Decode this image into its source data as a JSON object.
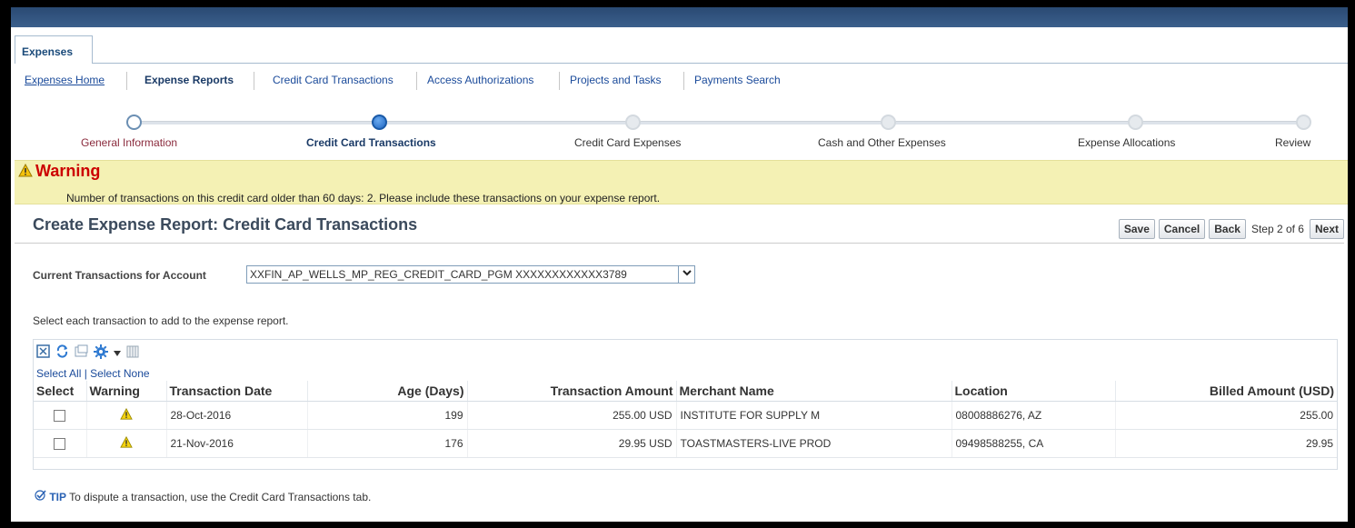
{
  "nav": {
    "tab": "Expenses",
    "subnav": [
      "Expenses Home",
      "Expense Reports",
      "Credit Card Transactions",
      "Access Authorizations",
      "Projects and Tasks",
      "Payments Search"
    ]
  },
  "train": [
    "General Information",
    "Credit Card Transactions",
    "Credit Card Expenses",
    "Cash and Other Expenses",
    "Expense Allocations",
    "Review"
  ],
  "warning": {
    "title": "Warning",
    "message": "Number of transactions on this credit card older than 60 days: 2. Please include these transactions on your expense report."
  },
  "page": {
    "title": "Create Expense Report: Credit Card Transactions",
    "buttons": {
      "save": "Save",
      "cancel": "Cancel",
      "back": "Back",
      "next": "Next"
    },
    "step": "Step 2 of 6"
  },
  "account": {
    "label": "Current Transactions for Account",
    "value": "XXFIN_AP_WELLS_MP_REG_CREDIT_CARD_PGM XXXXXXXXXXXX3789"
  },
  "instruction": "Select each transaction to add to the expense report.",
  "table": {
    "select_all": "Select All",
    "select_none": "Select None",
    "select_sep": "|",
    "headers": [
      "Select",
      "Warning",
      "Transaction Date",
      "Age (Days)",
      "Transaction Amount",
      "Merchant Name",
      "Location",
      "Billed Amount (USD)"
    ],
    "rows": [
      {
        "date": "28-Oct-2016",
        "age": "199",
        "amount": "255.00 USD",
        "merchant": "INSTITUTE FOR SUPPLY M",
        "location": "08008886276, AZ",
        "billed": "255.00"
      },
      {
        "date": "21-Nov-2016",
        "age": "176",
        "amount": "29.95 USD",
        "merchant": "TOASTMASTERS-LIVE PROD",
        "location": "09498588255, CA",
        "billed": "29.95"
      }
    ]
  },
  "tip": {
    "label": "TIP",
    "text": "To dispute a transaction, use the Credit Card Transactions tab."
  }
}
